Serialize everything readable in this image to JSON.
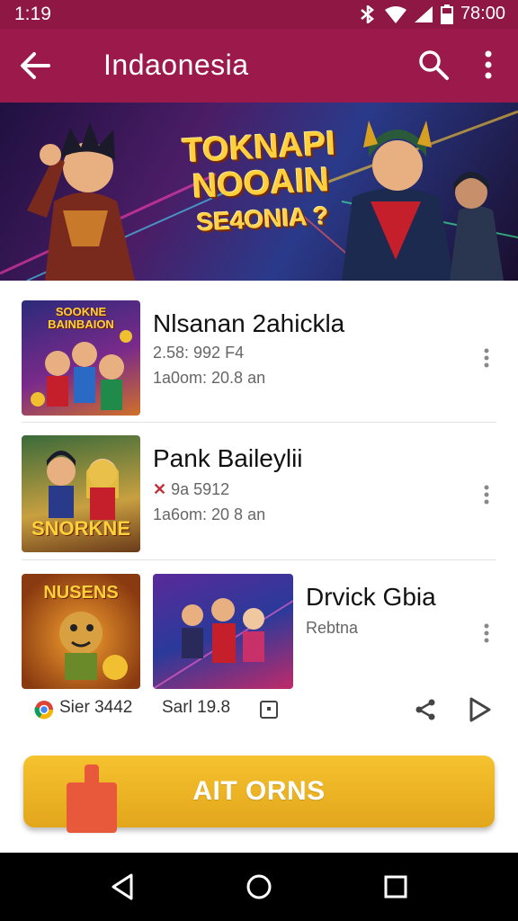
{
  "status_bar": {
    "time": "1:19",
    "right_time": "78:00",
    "icons": [
      "bluetooth-icon",
      "wifi-icon",
      "signal-icon",
      "battery-icon"
    ]
  },
  "app_bar": {
    "title": "Indaonesia",
    "background": "#9b1a4b"
  },
  "banner": {
    "line1": "TOKNAPI",
    "line2": "NOOAIN",
    "line3": "SE4ONIA ?"
  },
  "list": [
    {
      "thumb_caption": "SOOKNE BAINBAION",
      "name": "Nlsanan 2ahickla",
      "line1": "2.58: 992 F4",
      "line2": "1a0om: 20.8 an"
    },
    {
      "thumb_caption": "SNORKNE",
      "name": "Pank Baileylii",
      "line1": "9a 5912",
      "line2": "1a6om: 20 8 an"
    },
    {
      "thumb_caption": "NUSENS",
      "name": "Drvick Gbia",
      "line1": "Rebtna"
    }
  ],
  "actions": {
    "item1": "Sier 3442",
    "item2": "Sarl 19.8"
  },
  "cta": {
    "label": "AIT ORNS",
    "color": "#f2b926"
  }
}
